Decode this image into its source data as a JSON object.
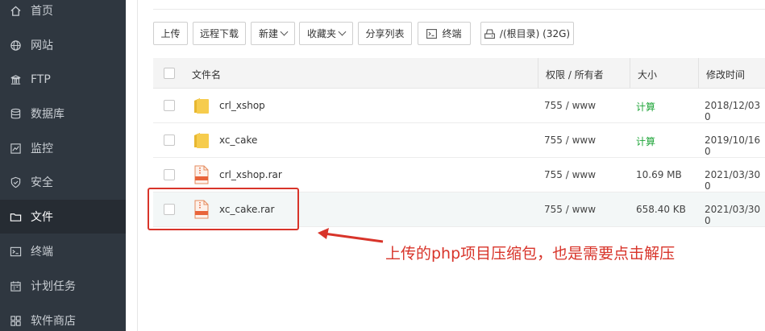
{
  "sidebar": {
    "items": [
      {
        "label": "首页",
        "icon": "home-icon"
      },
      {
        "label": "网站",
        "icon": "globe-icon"
      },
      {
        "label": "FTP",
        "icon": "ftp-icon"
      },
      {
        "label": "数据库",
        "icon": "database-icon"
      },
      {
        "label": "监控",
        "icon": "monitor-icon"
      },
      {
        "label": "安全",
        "icon": "shield-icon"
      },
      {
        "label": "文件",
        "icon": "folder-icon",
        "active": true
      },
      {
        "label": "终端",
        "icon": "terminal-icon"
      },
      {
        "label": "计划任务",
        "icon": "calendar-icon"
      },
      {
        "label": "软件商店",
        "icon": "store-icon"
      }
    ]
  },
  "toolbar": {
    "upload": "上传",
    "remote_download": "远程下载",
    "new": "新建",
    "favorites": "收藏夹",
    "share_list": "分享列表",
    "terminal": "终端",
    "path": "/(根目录) (32G)"
  },
  "table": {
    "headers": {
      "name": "文件名",
      "perm": "权限 / 所有者",
      "size": "大小",
      "mtime": "修改时间"
    },
    "rows": [
      {
        "name": "crl_xshop",
        "type": "folder",
        "perm": "755 / www",
        "size": "计算",
        "mtime": "2018/12/03 0"
      },
      {
        "name": "xc_cake",
        "type": "folder",
        "perm": "755 / www",
        "size": "计算",
        "mtime": "2019/10/16 0"
      },
      {
        "name": "crl_xshop.rar",
        "type": "rar",
        "perm": "755 / www",
        "size": "10.69 MB",
        "mtime": "2021/03/30 0"
      },
      {
        "name": "xc_cake.rar",
        "type": "rar",
        "perm": "755 / www",
        "size": "658.40 KB",
        "mtime": "2021/03/30 0"
      }
    ]
  },
  "annotation": {
    "text": "上传的php项目压缩包，也是需要点击解压",
    "color": "#d8342a"
  }
}
